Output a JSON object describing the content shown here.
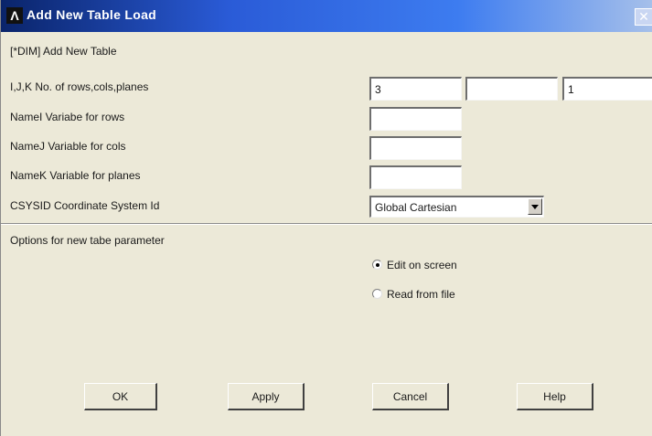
{
  "window": {
    "title": "Add New Table Load",
    "logo_letter": "Λ",
    "close_glyph": "✕"
  },
  "form": {
    "command": "[*DIM] Add New Table",
    "rows": [
      {
        "label": "I,J,K  No. of rows,cols,planes"
      },
      {
        "label": "NameI  Variabe for rows"
      },
      {
        "label": "NameJ  Variable for cols"
      },
      {
        "label": "NameK  Variable for planes"
      },
      {
        "label": "CSYSID  Coordinate System Id"
      }
    ],
    "dims": {
      "i": "3",
      "j": "",
      "k": "1"
    },
    "var_rows": "",
    "var_cols": "",
    "var_planes": "",
    "csys": {
      "value": "Global Cartesian"
    }
  },
  "options": {
    "heading": "Options for new tabe parameter",
    "items": [
      {
        "label": "Edit on screen",
        "selected": true
      },
      {
        "label": "Read from file",
        "selected": false
      }
    ]
  },
  "buttons": {
    "ok": "OK",
    "apply": "Apply",
    "cancel": "Cancel",
    "help": "Help"
  }
}
